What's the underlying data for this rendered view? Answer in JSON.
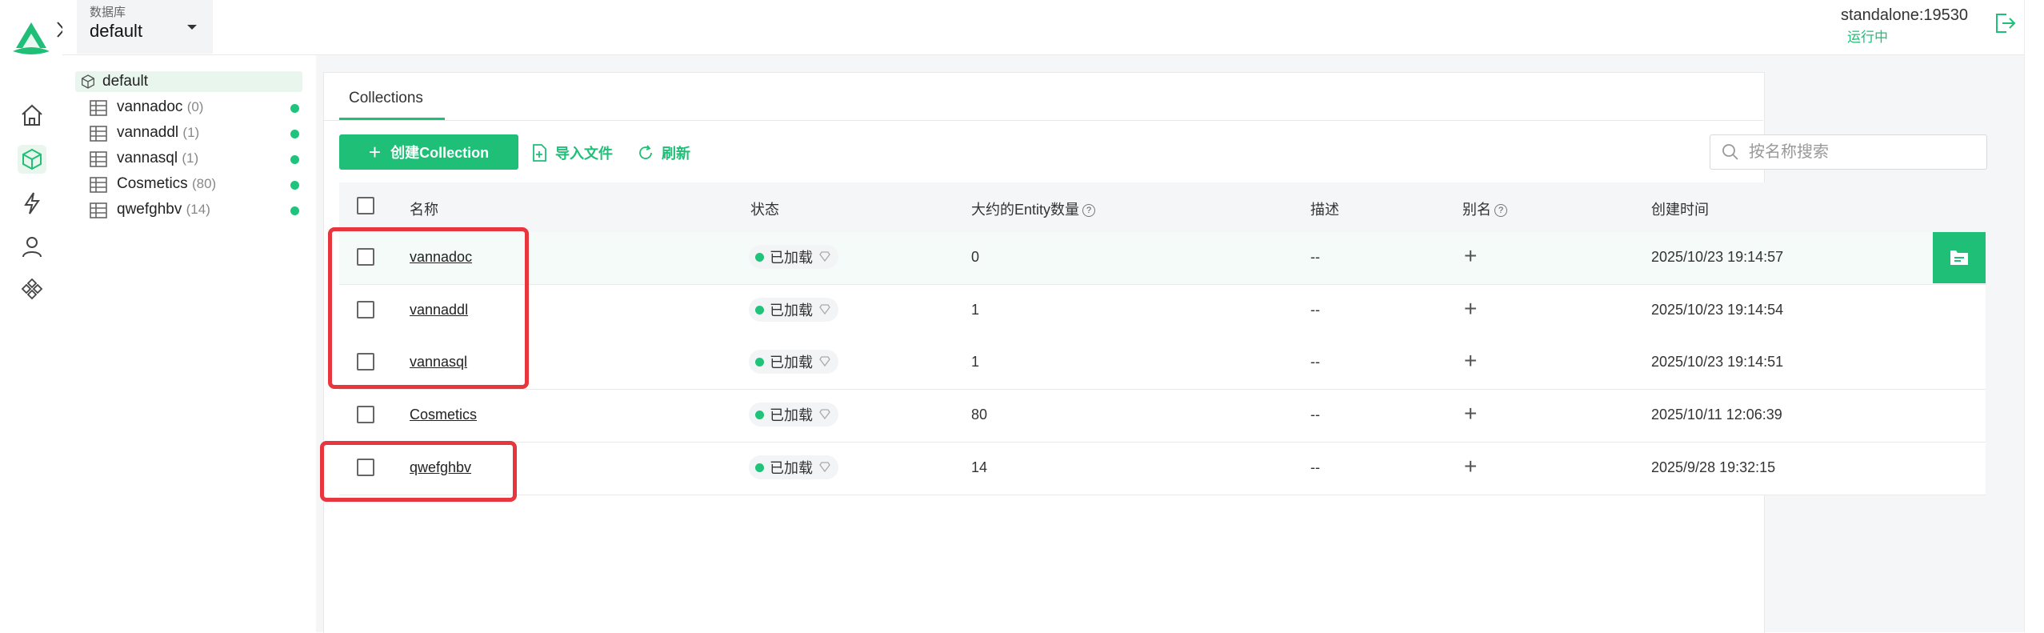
{
  "header": {
    "database_label": "数据库",
    "database_value": "default",
    "server_name": "standalone:19530",
    "server_status": "运行中"
  },
  "sidebar": {
    "root": "default",
    "items": [
      {
        "name": "vannadoc",
        "count": "(0)"
      },
      {
        "name": "vannaddl",
        "count": "(1)"
      },
      {
        "name": "vannasql",
        "count": "(1)"
      },
      {
        "name": "Cosmetics",
        "count": "(80)"
      },
      {
        "name": "qwefghbv",
        "count": "(14)"
      }
    ]
  },
  "main": {
    "tab": "Collections",
    "create_button": "创建Collection",
    "import_button": "导入文件",
    "refresh_button": "刷新",
    "search_placeholder": "按名称搜索"
  },
  "table": {
    "headers": {
      "name": "名称",
      "status": "状态",
      "entity_count": "大约的Entity数量",
      "description": "描述",
      "alias": "别名",
      "created": "创建时间"
    },
    "rows": [
      {
        "name": "vannadoc",
        "status": "已加载",
        "entities": "0",
        "description": "--",
        "created": "2025/10/23 19:14:57"
      },
      {
        "name": "vannaddl",
        "status": "已加载",
        "entities": "1",
        "description": "--",
        "created": "2025/10/23 19:14:54"
      },
      {
        "name": "vannasql",
        "status": "已加载",
        "entities": "1",
        "description": "--",
        "created": "2025/10/23 19:14:51"
      },
      {
        "name": "Cosmetics",
        "status": "已加载",
        "entities": "80",
        "description": "--",
        "created": "2025/10/11 12:06:39"
      },
      {
        "name": "qwefghbv",
        "status": "已加载",
        "entities": "14",
        "description": "--",
        "created": "2025/9/28 19:32:15"
      }
    ]
  },
  "colors": {
    "accent": "#1fbf77",
    "highlight": "#e8363f"
  }
}
